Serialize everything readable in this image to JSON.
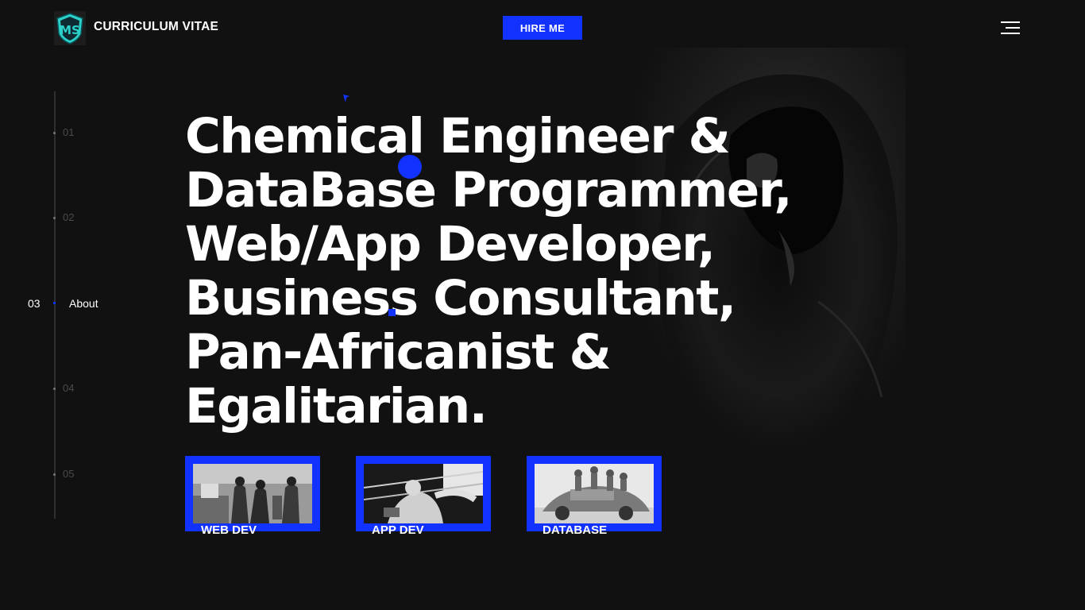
{
  "header": {
    "logo_text": "MS",
    "title": "CURRICULUM VITAE",
    "hire_button": "HIRE ME",
    "menu_icon": "hamburger-menu-icon"
  },
  "side_nav": {
    "items": [
      {
        "number": "01"
      },
      {
        "number": "02"
      },
      {
        "number": "03",
        "label": "About",
        "active": true
      },
      {
        "number": "04"
      },
      {
        "number": "05"
      }
    ]
  },
  "hero": {
    "lines": [
      "Chemical Engineer &",
      "DataBase Programmer,",
      "Web/App Developer,",
      "Business Consultant,",
      "Pan-Africanist &",
      "Egalitarian."
    ]
  },
  "cards": [
    {
      "label": "WEB DEV",
      "image": "men-standing-street-photo"
    },
    {
      "label": "APP DEV",
      "image": "boxer-in-ring-photo"
    },
    {
      "label": "DATABASE",
      "image": "people-on-vintage-car-photo"
    }
  ],
  "colors": {
    "background": "#111111",
    "accent": "#1233ff",
    "text": "#ffffff",
    "muted": "#4a4a4a"
  }
}
